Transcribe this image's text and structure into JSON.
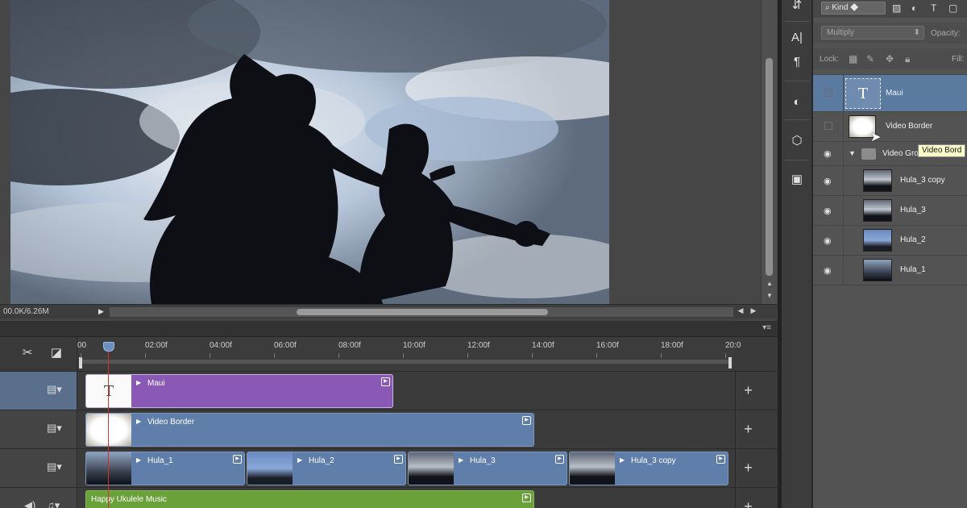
{
  "document": {
    "size_readout": "00.0K/6.26M"
  },
  "timeline": {
    "ruler_ticks": [
      "00",
      "02:00f",
      "04:00f",
      "06:00f",
      "08:00f",
      "10:00f",
      "12:00f",
      "14:00f",
      "16:00f",
      "18:00f",
      "20:0"
    ],
    "tracks": [
      {
        "clips": [
          {
            "label": "Maui",
            "color": "#8a59b5",
            "thumb": "text"
          }
        ]
      },
      {
        "clips": [
          {
            "label": "Video Border",
            "color": "#5f7faa",
            "thumb": "border"
          }
        ]
      },
      {
        "clips": [
          {
            "label": "Hula_1",
            "color": "#5f7faa",
            "thumb": "photo"
          },
          {
            "label": "Hula_2",
            "color": "#5f7faa",
            "thumb": "photo"
          },
          {
            "label": "Hula_3",
            "color": "#5f7faa",
            "thumb": "photo"
          },
          {
            "label": "Hula_3 copy",
            "color": "#5f7faa",
            "thumb": "photo"
          }
        ]
      },
      {
        "clips": [
          {
            "label": "Happy Ukulele Music",
            "color": "#6aa13a",
            "thumb": "none"
          }
        ]
      }
    ],
    "text_thumb_glyph": "T",
    "add_glyph": "+"
  },
  "layers_panel": {
    "kind_filter": "Kind",
    "blend_mode": "Multiply",
    "opacity_label": "Opacity:",
    "lock_label": "Lock:",
    "fill_label": "Fill:",
    "group_name": "Video Gro",
    "layers": [
      {
        "name": "Maui",
        "thumb": "text",
        "visible": false,
        "selected": true
      },
      {
        "name": "Video Border",
        "thumb": "border",
        "visible": false,
        "selected": false
      },
      {
        "name": "Hula_3 copy",
        "thumb": "photo",
        "visible": true,
        "selected": false
      },
      {
        "name": "Hula_3",
        "thumb": "photo",
        "visible": true,
        "selected": false
      },
      {
        "name": "Hula_2",
        "thumb": "photo",
        "visible": true,
        "selected": false
      },
      {
        "name": "Hula_1",
        "thumb": "photo",
        "visible": true,
        "selected": false
      }
    ],
    "tooltip": "Video Bord"
  },
  "colors": {
    "selection": "#5a7aa0",
    "playhead": "#d0342c",
    "purple_clip": "#8a59b5",
    "blue_clip": "#5f7faa",
    "green_clip": "#6aa13a"
  }
}
